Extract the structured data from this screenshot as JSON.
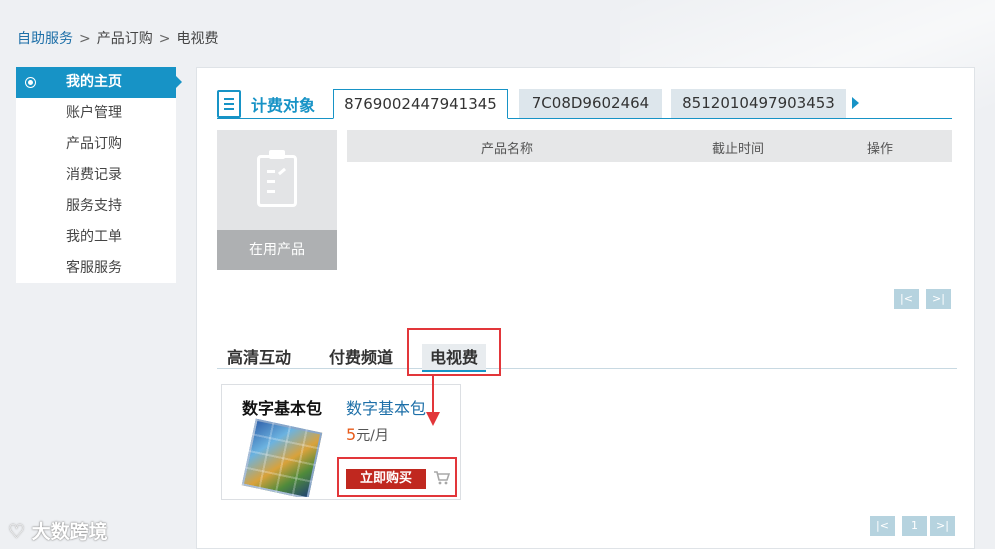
{
  "breadcrumb": {
    "home": "自助服务",
    "sep1": ">",
    "level2": "产品订购",
    "sep2": ">",
    "current": "电视费"
  },
  "sidebar": {
    "items": [
      {
        "label": "我的主页",
        "active": true
      },
      {
        "label": "账户管理"
      },
      {
        "label": "产品订购"
      },
      {
        "label": "消费记录"
      },
      {
        "label": "服务支持"
      },
      {
        "label": "我的工单"
      },
      {
        "label": "客服服务"
      }
    ]
  },
  "billing": {
    "title": "计费对象",
    "accounts": [
      "8769002447941345",
      "7C08D9602464",
      "8512010497903453"
    ]
  },
  "in_use": {
    "label": "在用产品"
  },
  "table": {
    "col_name": "产品名称",
    "col_deadline": "截止时间",
    "col_action": "操作"
  },
  "pager_top": {
    "first": "|<",
    "last": ">|"
  },
  "categories": {
    "tabs": [
      "高清互动",
      "付费频道",
      "电视费"
    ],
    "selected": "电视费"
  },
  "product": {
    "image_title": "数字基本包",
    "name": "数字基本包",
    "price_num": "5",
    "price_unit": "元/月",
    "buy_label": "立即购买"
  },
  "pager_bottom": {
    "first": "|<",
    "page": "1",
    "last": ">|"
  },
  "watermark": "大数跨境",
  "colors": {
    "accent": "#1793c6",
    "highlight": "#e2363a",
    "buy": "#c0281f",
    "price": "#e85b1a"
  }
}
